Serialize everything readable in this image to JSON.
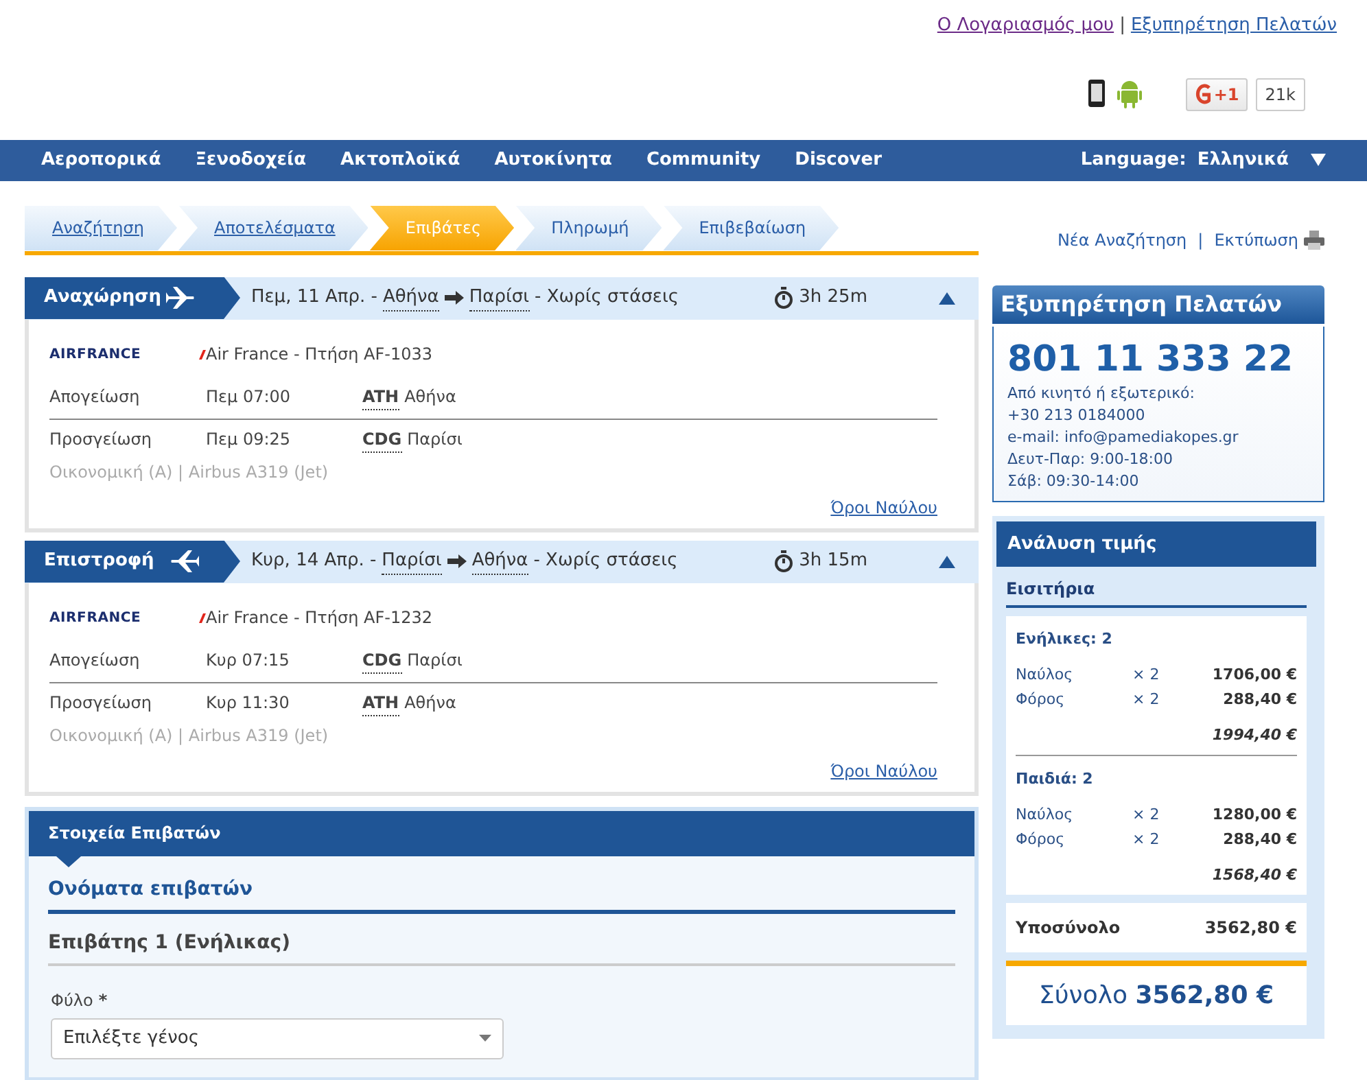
{
  "top_links": {
    "links": [
      {
        "label": "Ο Λογαριασμός μου",
        "visited": true
      },
      {
        "label": "Εξυπηρέτηση Πελατών",
        "visited": false
      }
    ],
    "separator": "|"
  },
  "social": {
    "plus_label": "+1",
    "count": "21k"
  },
  "nav": {
    "items": [
      "Αεροπορικά",
      "Ξενοδοχεία",
      "Ακτοπλοϊκά",
      "Αυτοκίνητα",
      "Community",
      "Discover"
    ],
    "language_label": "Language:",
    "language_value": "Ελληνικά"
  },
  "steps": [
    {
      "label": "Αναζήτηση",
      "selected": false,
      "completed": true
    },
    {
      "label": "Αποτελέσματα",
      "selected": false,
      "completed": true
    },
    {
      "label": "Επιβάτες",
      "selected": true,
      "completed": false
    },
    {
      "label": "Πληρωμή",
      "selected": false,
      "completed": false
    },
    {
      "label": "Επιβεβαίωση",
      "selected": false,
      "completed": false
    }
  ],
  "actions": {
    "new_search": "Νέα Αναζήτηση",
    "separator": "|",
    "print": "Εκτύπωση"
  },
  "flights": [
    {
      "kind": "outbound",
      "title": "Αναχώρηση",
      "date": "Πεμ, 11 Απρ. -",
      "from": "Αθήνα",
      "to": "Παρίσι",
      "stops": "- Χωρίς στάσεις",
      "duration": "3h 25m",
      "expanded": true,
      "airline_logo": "AIRFRANCE",
      "flight": "Air France - Πτήση AF-1033",
      "legs": [
        {
          "label": "Απογείωση",
          "time": "Πεμ 07:00",
          "code": "ATH",
          "city": "Αθήνα"
        },
        {
          "label": "Προσγείωση",
          "time": "Πεμ 09:25",
          "code": "CDG",
          "city": "Παρίσι"
        }
      ],
      "cabin": "Οικονομική (Α) | Airbus A319 (Jet)",
      "fare_link": "Όροι Ναύλου"
    },
    {
      "kind": "return",
      "title": "Επιστροφή",
      "date": "Κυρ, 14 Απρ. -",
      "from": "Παρίσι",
      "to": "Αθήνα",
      "stops": "- Χωρίς στάσεις",
      "duration": "3h 15m",
      "expanded": true,
      "airline_logo": "AIRFRANCE",
      "flight": "Air France - Πτήση AF-1232",
      "legs": [
        {
          "label": "Απογείωση",
          "time": "Κυρ 07:15",
          "code": "CDG",
          "city": "Παρίσι"
        },
        {
          "label": "Προσγείωση",
          "time": "Κυρ 11:30",
          "code": "ATH",
          "city": "Αθήνα"
        }
      ],
      "cabin": "Οικονομική (Α) | Airbus A319 (Jet)",
      "fare_link": "Όροι Ναύλου"
    }
  ],
  "passengers": {
    "title": "Στοιχεία Επιβατών",
    "subtitle": "Ονόματα επιβατών",
    "passenger": "Επιβάτης 1 (Ενήλικας)",
    "gender_label": "Φύλο",
    "required_mark": "*",
    "gender_placeholder": "Επιλέξτε γένος"
  },
  "customer_service": {
    "title": "Εξυπηρέτηση Πελατών",
    "phone": "801 11 333 22",
    "lines": [
      "Από κινητό ή εξωτερικό:",
      "+30 213 0184000",
      "e-mail: info@pamediakopes.gr",
      "Δευτ-Παρ: 9:00-18:00",
      "Σάβ: 09:30-14:00"
    ]
  },
  "price": {
    "title": "Ανάλυση τιμής",
    "section": "Εισιτήρια",
    "groups": [
      {
        "heading": "Ενήλικες: 2",
        "items": [
          {
            "label": "Ναύλος",
            "qty": "× 2",
            "amount": "1706,00 €"
          },
          {
            "label": "Φόρος",
            "qty": "× 2",
            "amount": "288,40 €"
          }
        ],
        "subtotal": "1994,40 €"
      },
      {
        "heading": "Παιδιά: 2",
        "items": [
          {
            "label": "Ναύλος",
            "qty": "× 2",
            "amount": "1280,00 €"
          },
          {
            "label": "Φόρος",
            "qty": "× 2",
            "amount": "288,40 €"
          }
        ],
        "subtotal": "1568,40 €"
      }
    ],
    "subtotal_label": "Υποσύνολο",
    "subtotal_value": "3562,80 €",
    "total": "Σύνολο **3562,80 €**"
  }
}
